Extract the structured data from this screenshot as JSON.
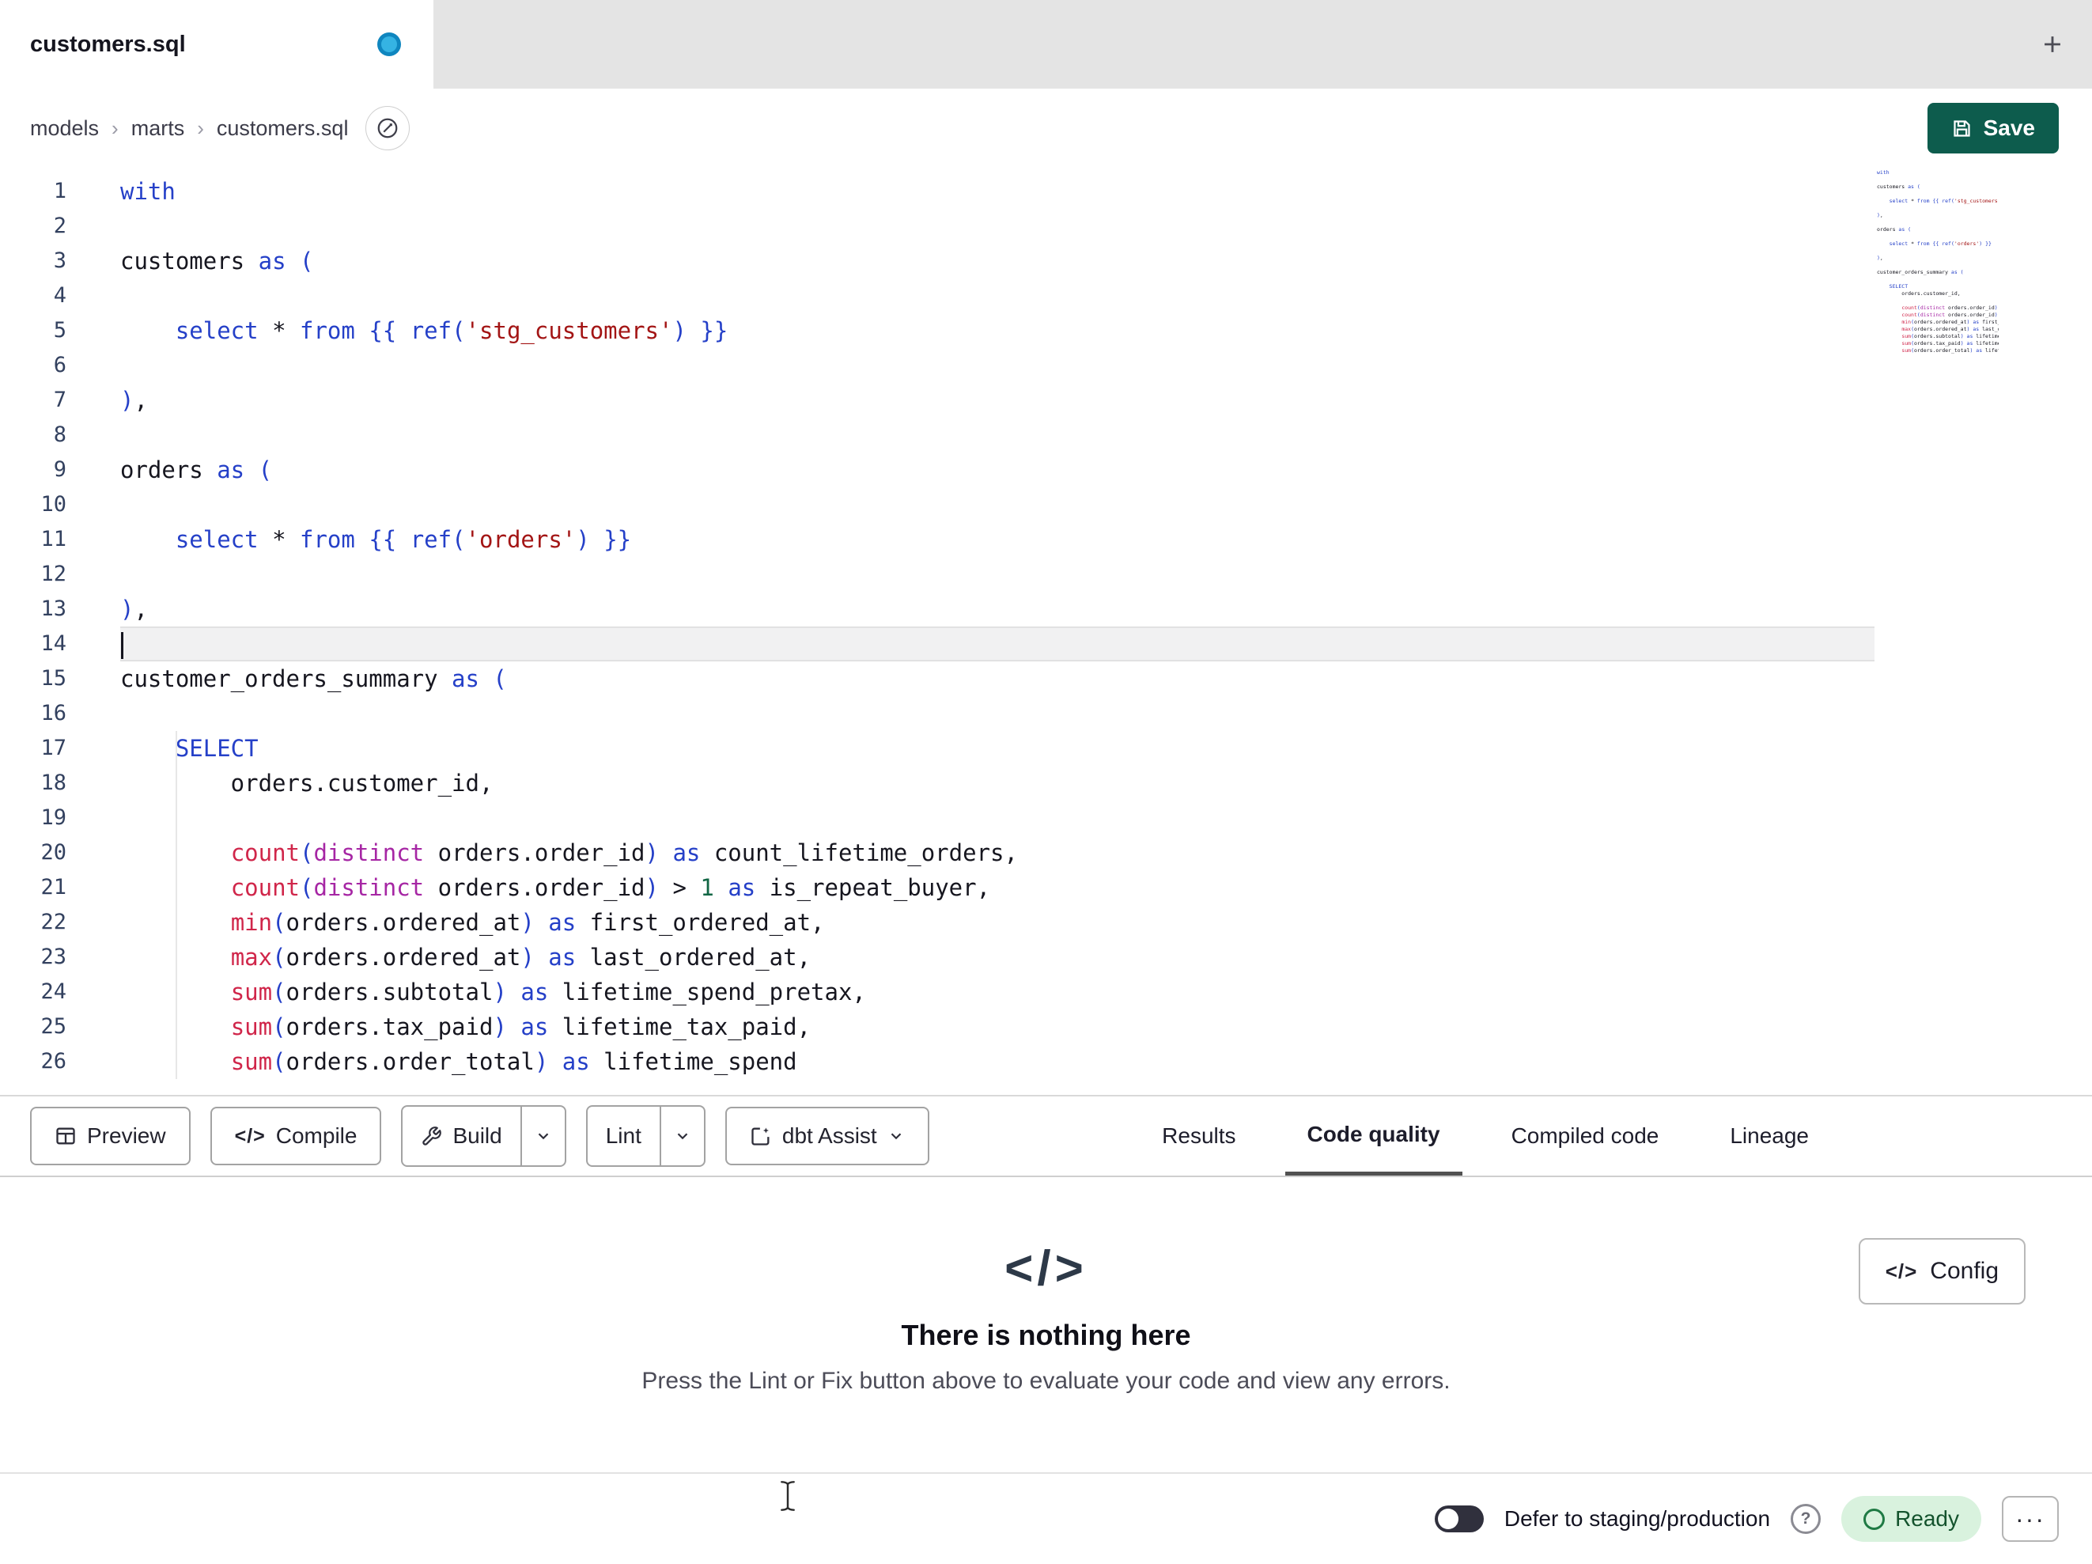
{
  "window": {
    "active_tab_title": "customers.sql",
    "modified": true
  },
  "breadcrumb": {
    "items": [
      "models",
      "marts",
      "customers.sql"
    ],
    "separator": "›"
  },
  "header": {
    "save_label": "Save"
  },
  "editor": {
    "active_line": 14,
    "lines": [
      {
        "n": 1,
        "tokens": [
          [
            "k",
            "with"
          ]
        ]
      },
      {
        "n": 2,
        "tokens": []
      },
      {
        "n": 3,
        "tokens": [
          [
            "p",
            "customers "
          ],
          [
            "k",
            "as"
          ],
          [
            "p",
            " "
          ],
          [
            "b",
            "("
          ]
        ]
      },
      {
        "n": 4,
        "tokens": []
      },
      {
        "n": 5,
        "tokens": [
          [
            "p",
            "    "
          ],
          [
            "k",
            "select"
          ],
          [
            "p",
            " "
          ],
          [
            "op",
            "*"
          ],
          [
            "p",
            " "
          ],
          [
            "k",
            "from"
          ],
          [
            "p",
            " "
          ],
          [
            "j",
            "{{"
          ],
          [
            "p",
            " "
          ],
          [
            "r",
            "ref"
          ],
          [
            "b",
            "("
          ],
          [
            "s",
            "'stg_customers'"
          ],
          [
            "b",
            ")"
          ],
          [
            "p",
            " "
          ],
          [
            "j",
            "}}"
          ]
        ]
      },
      {
        "n": 6,
        "tokens": []
      },
      {
        "n": 7,
        "tokens": [
          [
            "b",
            ")"
          ],
          [
            "p",
            ","
          ]
        ]
      },
      {
        "n": 8,
        "tokens": []
      },
      {
        "n": 9,
        "tokens": [
          [
            "p",
            "orders "
          ],
          [
            "k",
            "as"
          ],
          [
            "p",
            " "
          ],
          [
            "b",
            "("
          ]
        ]
      },
      {
        "n": 10,
        "tokens": []
      },
      {
        "n": 11,
        "tokens": [
          [
            "p",
            "    "
          ],
          [
            "k",
            "select"
          ],
          [
            "p",
            " "
          ],
          [
            "op",
            "*"
          ],
          [
            "p",
            " "
          ],
          [
            "k",
            "from"
          ],
          [
            "p",
            " "
          ],
          [
            "j",
            "{{"
          ],
          [
            "p",
            " "
          ],
          [
            "r",
            "ref"
          ],
          [
            "b",
            "("
          ],
          [
            "s",
            "'orders'"
          ],
          [
            "b",
            ")"
          ],
          [
            "p",
            " "
          ],
          [
            "j",
            "}}"
          ]
        ]
      },
      {
        "n": 12,
        "tokens": []
      },
      {
        "n": 13,
        "tokens": [
          [
            "b",
            ")"
          ],
          [
            "p",
            ","
          ]
        ]
      },
      {
        "n": 14,
        "tokens": []
      },
      {
        "n": 15,
        "tokens": [
          [
            "p",
            "customer_orders_summary "
          ],
          [
            "k",
            "as"
          ],
          [
            "p",
            " "
          ],
          [
            "b",
            "("
          ]
        ]
      },
      {
        "n": 16,
        "tokens": []
      },
      {
        "n": 17,
        "tokens": [
          [
            "p",
            "    "
          ],
          [
            "k",
            "SELECT"
          ]
        ]
      },
      {
        "n": 18,
        "tokens": [
          [
            "p",
            "        orders.customer_id,"
          ]
        ]
      },
      {
        "n": 19,
        "tokens": []
      },
      {
        "n": 20,
        "tokens": [
          [
            "p",
            "        "
          ],
          [
            "fn",
            "count"
          ],
          [
            "b",
            "("
          ],
          [
            "t",
            "distinct"
          ],
          [
            "p",
            " orders.order_id"
          ],
          [
            "b",
            ")"
          ],
          [
            "p",
            " "
          ],
          [
            "k",
            "as"
          ],
          [
            "p",
            " count_lifetime_orders,"
          ]
        ]
      },
      {
        "n": 21,
        "tokens": [
          [
            "p",
            "        "
          ],
          [
            "fn",
            "count"
          ],
          [
            "b",
            "("
          ],
          [
            "t",
            "distinct"
          ],
          [
            "p",
            " orders.order_id"
          ],
          [
            "b",
            ")"
          ],
          [
            "p",
            " > "
          ],
          [
            "n",
            "1"
          ],
          [
            "p",
            " "
          ],
          [
            "k",
            "as"
          ],
          [
            "p",
            " is_repeat_buyer,"
          ]
        ]
      },
      {
        "n": 22,
        "tokens": [
          [
            "p",
            "        "
          ],
          [
            "fn",
            "min"
          ],
          [
            "b",
            "("
          ],
          [
            "p",
            "orders.ordered_at"
          ],
          [
            "b",
            ")"
          ],
          [
            "p",
            " "
          ],
          [
            "k",
            "as"
          ],
          [
            "p",
            " first_ordered_at,"
          ]
        ]
      },
      {
        "n": 23,
        "tokens": [
          [
            "p",
            "        "
          ],
          [
            "fn",
            "max"
          ],
          [
            "b",
            "("
          ],
          [
            "p",
            "orders.ordered_at"
          ],
          [
            "b",
            ")"
          ],
          [
            "p",
            " "
          ],
          [
            "k",
            "as"
          ],
          [
            "p",
            " last_ordered_at,"
          ]
        ]
      },
      {
        "n": 24,
        "tokens": [
          [
            "p",
            "        "
          ],
          [
            "fn",
            "sum"
          ],
          [
            "b",
            "("
          ],
          [
            "p",
            "orders.subtotal"
          ],
          [
            "b",
            ")"
          ],
          [
            "p",
            " "
          ],
          [
            "k",
            "as"
          ],
          [
            "p",
            " lifetime_spend_pretax,"
          ]
        ]
      },
      {
        "n": 25,
        "tokens": [
          [
            "p",
            "        "
          ],
          [
            "fn",
            "sum"
          ],
          [
            "b",
            "("
          ],
          [
            "p",
            "orders.tax_paid"
          ],
          [
            "b",
            ")"
          ],
          [
            "p",
            " "
          ],
          [
            "k",
            "as"
          ],
          [
            "p",
            " lifetime_tax_paid,"
          ]
        ]
      },
      {
        "n": 26,
        "tokens": [
          [
            "p",
            "        "
          ],
          [
            "fn",
            "sum"
          ],
          [
            "b",
            "("
          ],
          [
            "p",
            "orders.order_total"
          ],
          [
            "b",
            ")"
          ],
          [
            "p",
            " "
          ],
          [
            "k",
            "as"
          ],
          [
            "p",
            " lifetime_spend"
          ]
        ]
      }
    ]
  },
  "toolbar": {
    "preview_label": "Preview",
    "compile_label": "Compile",
    "build_label": "Build",
    "lint_label": "Lint",
    "dbt_assist_label": "dbt Assist",
    "compile_icon_glyph": "</>"
  },
  "panel_tabs": {
    "results": "Results",
    "code_quality": "Code quality",
    "compiled_code": "Compiled code",
    "lineage": "Lineage",
    "active_tab": "Code quality"
  },
  "empty_state": {
    "icon_glyph": "</>",
    "title": "There is nothing here",
    "subtitle": "Press the Lint or Fix button above to evaluate your code and view any errors."
  },
  "config_button": {
    "icon_glyph": "</>",
    "label": "Config"
  },
  "status_bar": {
    "defer_label": "Defer to staging/production",
    "defer_toggle_on": false,
    "help_glyph": "?",
    "ready_label": "Ready",
    "menu_glyph": "···"
  },
  "colors": {
    "save_button": "#0d5c4d",
    "unsaved_dot": "#35b3e3",
    "ready_bg": "#d9f2de",
    "ready_text": "#14532d",
    "syntax_keyword": "#2540c8",
    "syntax_function": "#d0264a",
    "syntax_string": "#a31515",
    "syntax_distinct": "#a626a4",
    "syntax_number": "#116644"
  }
}
